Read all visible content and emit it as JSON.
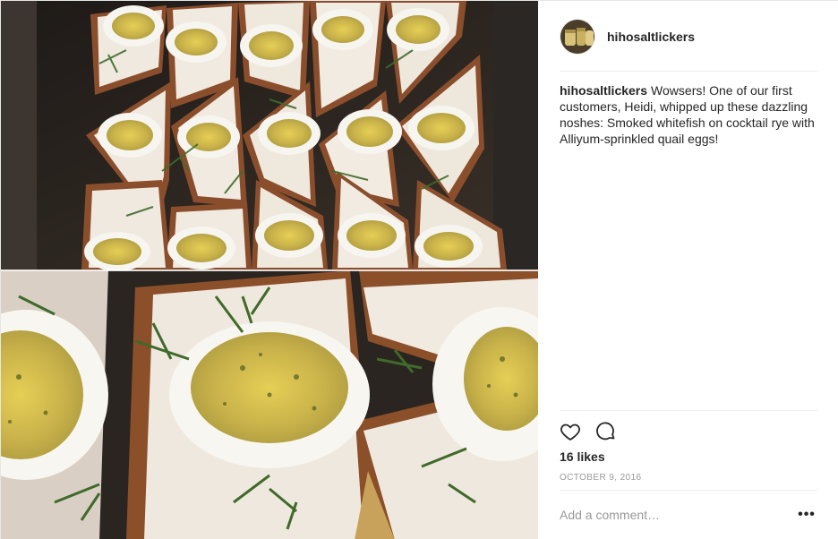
{
  "post": {
    "username": "hihosaltlickers",
    "caption_user": "hihosaltlickers",
    "caption_text": "Wowsers! One of our first customers, Heidi, whipped up these dazzling noshes: Smoked whitefish on cocktail rye with Alliyum-sprinkled quail eggs!",
    "likes": "16 likes",
    "date": "OCTOBER 9, 2016",
    "comment_placeholder": "Add a comment…",
    "more_label": "•••"
  },
  "icons": {
    "like": "heart-icon",
    "comment": "comment-bubble-icon",
    "more": "more-options-icon"
  },
  "colors": {
    "text": "#262626",
    "muted": "#999999",
    "divider": "#efefef",
    "border": "#e6e6e6"
  }
}
